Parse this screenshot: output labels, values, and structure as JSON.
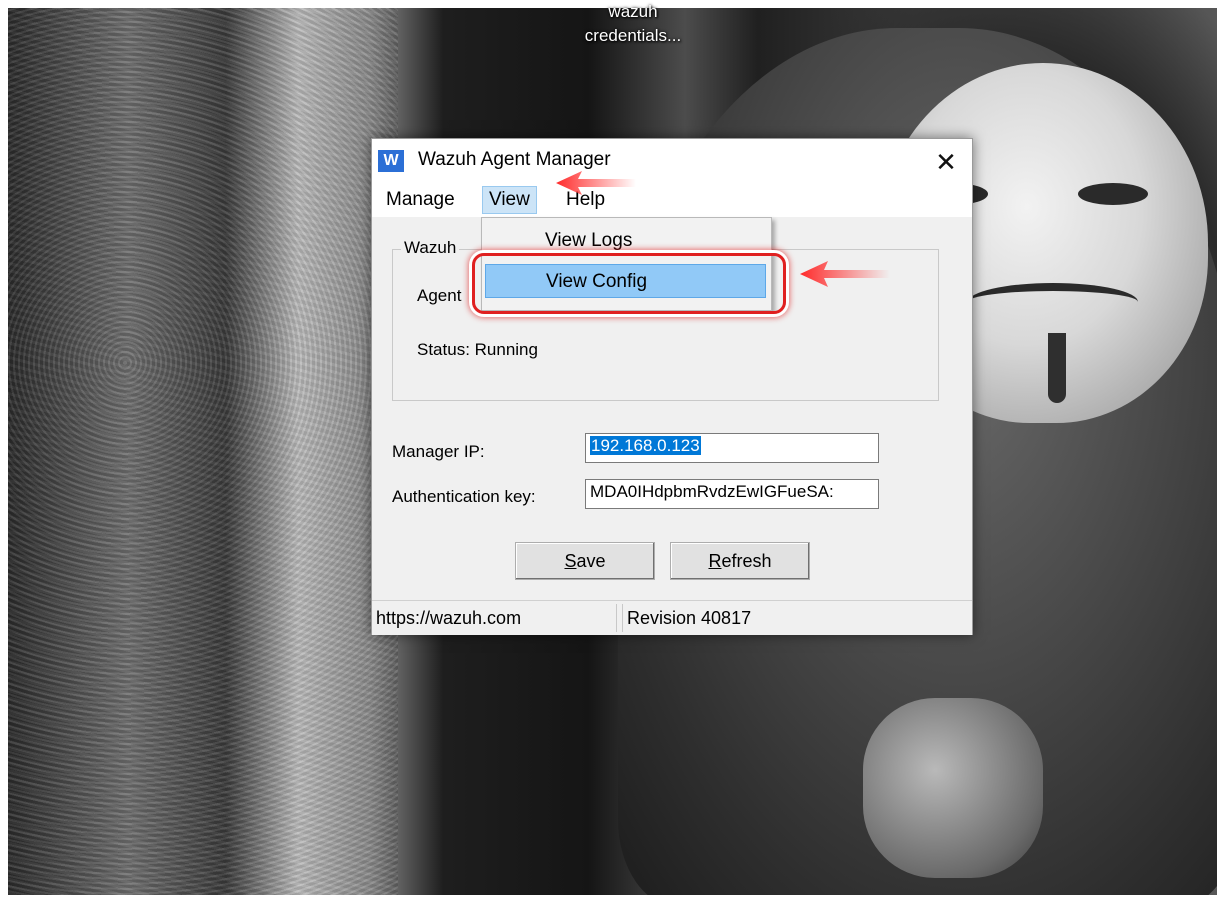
{
  "desktop": {
    "icon_label_line1": "wazuh",
    "icon_label_line2": "credentials..."
  },
  "window": {
    "app_icon": "W",
    "title": "Wazuh Agent Manager",
    "close_glyph": "✕"
  },
  "menu": {
    "manage": "Manage",
    "view": "View",
    "help": "Help"
  },
  "dropdown": {
    "items": [
      {
        "label": "View Logs",
        "highlighted": false
      },
      {
        "label": "View Config",
        "highlighted": true
      }
    ]
  },
  "group": {
    "legend": "Wazuh",
    "agent_label": "Agent",
    "status_label": "Status: Running"
  },
  "form": {
    "manager_ip_label": "Manager IP:",
    "manager_ip_value": "192.168.0.123",
    "auth_key_label": "Authentication key:",
    "auth_key_value": "MDA0IHdpbmRvdzEwIGFueSA:"
  },
  "buttons": {
    "save_accel": "S",
    "save_rest": "ave",
    "refresh_accel": "R",
    "refresh_rest": "efresh"
  },
  "statusbar": {
    "url": "https://wazuh.com",
    "revision": "Revision 40817"
  },
  "colors": {
    "highlight_ring": "#e02020",
    "menu_hover": "#cce4f7",
    "dropdown_selected": "#91c9f7",
    "selection": "#0078d7"
  }
}
